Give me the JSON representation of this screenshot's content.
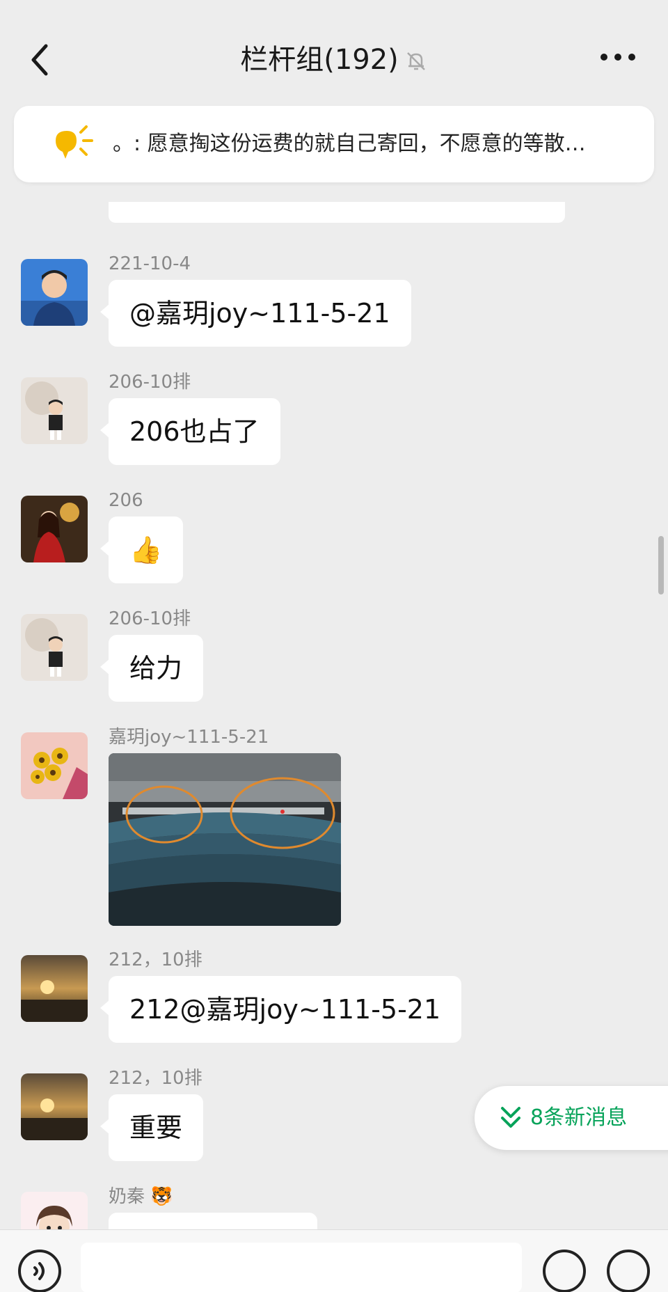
{
  "header": {
    "title": "栏杆组(192)"
  },
  "announcement": {
    "text": "。: 愿意掏这份运费的就自己寄回，不愿意的等散…"
  },
  "messages": [
    {
      "sender": "221-10-4",
      "text": "@嘉玥joy~111-5-21"
    },
    {
      "sender": "206-10排",
      "text": "206也占了"
    },
    {
      "sender": "206",
      "text": "👍"
    },
    {
      "sender": "206-10排",
      "text": "给力"
    },
    {
      "sender": "嘉玥joy~111-5-21",
      "text": ""
    },
    {
      "sender": "212，10排",
      "text": "212@嘉玥joy~111-5-21"
    },
    {
      "sender": "212，10排",
      "text": "重要"
    },
    {
      "sender": "奶秦 🐯",
      "text": ""
    }
  ],
  "new_messages": {
    "label": "8条新消息"
  },
  "icons": {
    "back": "chevron-left-icon",
    "mute": "bell-off-icon",
    "more": "more-dots-icon",
    "bulb": "announcement-bulb-icon",
    "voice": "voice-icon",
    "emoji": "emoji-icon",
    "plus": "plus-icon"
  },
  "colors": {
    "background": "#ededed",
    "bubble": "#ffffff",
    "accent_green": "#07a35a",
    "bulb_yellow": "#f5b800"
  }
}
